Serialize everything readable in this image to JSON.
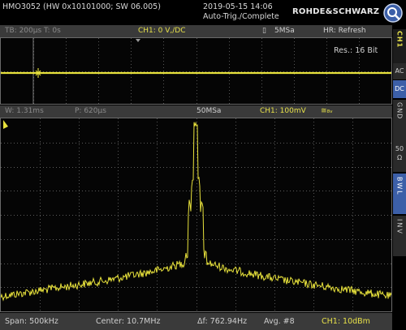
{
  "header": {
    "device_info": "HMO3052 (HW 0x10101000; SW 06.005)",
    "datetime": "2019-05-15 14:06",
    "trigger_status": "Auto-Trig./Complete",
    "brand": "ROHDE&SCHWARZ"
  },
  "top_bar": {
    "timebase": "TB: 200µs  T: 0s",
    "channel": "CH1: 0 V,/DC",
    "sample_rate": "5MSa",
    "hr_mode": "HR: Refresh"
  },
  "upper_panel": {
    "resolution": "Res.: 16 Bit"
  },
  "mid_bar": {
    "window": "W: 1.31ms",
    "position": "P: 620µs",
    "sample_rate": "50MSa",
    "channel": "CH1: 100mV"
  },
  "bottom_bar": {
    "span": "Span: 500kHz",
    "center": "Center: 10.7MHz",
    "delta_f": "Δf: 762.94Hz",
    "average": "Avg. #8",
    "channel": "CH1: 10dBm"
  },
  "side_menu": {
    "channel": "CH1",
    "ac": "AC",
    "dc": "DC",
    "gnd": "GND",
    "impedance_value": "50",
    "impedance_unit": "Ω",
    "bwl": "BWL",
    "inv": "INV"
  },
  "colors": {
    "trace": "#e8e23c",
    "background": "#000000",
    "grid": "#7a7a7a",
    "bar": "#3a3a3a",
    "side_active": "#3c5fa8"
  },
  "icons": {
    "search": "magnifier-icon",
    "channel_probe": "probe-icon",
    "trigger": "trigger-arrow-icon",
    "ground": "ground-marker-icon"
  }
}
